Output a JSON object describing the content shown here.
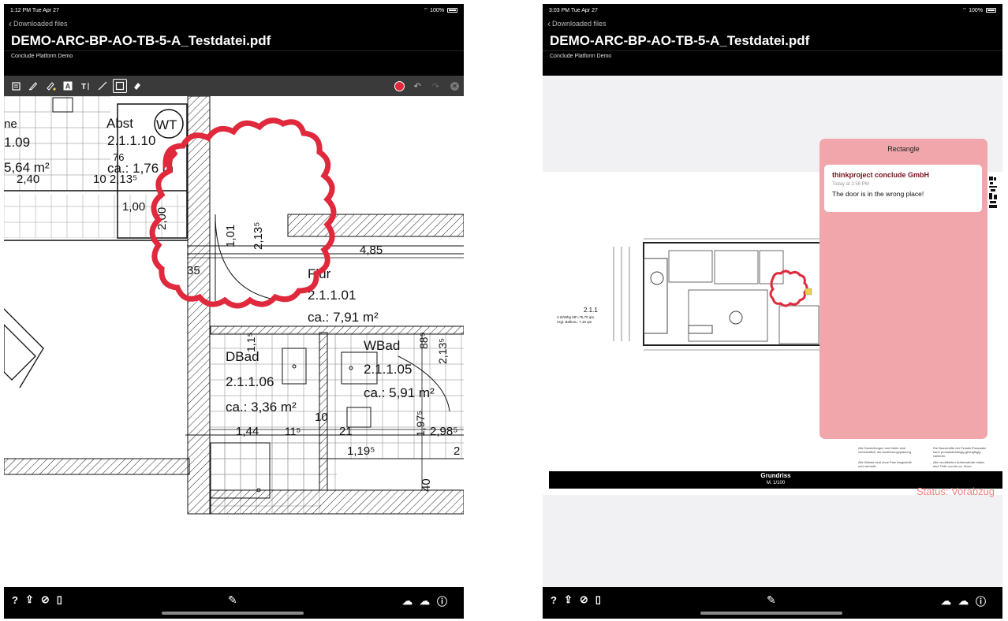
{
  "left": {
    "status": {
      "time": "1:12 PM  Tue Apr 27",
      "battery": "100%"
    },
    "back_label": "Downloaded files",
    "doc_title": "DEMO-ARC-BP-AO-TB-5-A_Testdatei.pdf",
    "project": "Conclude Platform Demo",
    "toolbar": {
      "tools": [
        "note-tool",
        "pen-tool",
        "highlighter-tool",
        "text-box-tool",
        "text-tool",
        "line-tool",
        "rectangle-tool",
        "eraser-tool"
      ],
      "selected_tool": "rectangle-tool",
      "active_color": "#e0293c"
    },
    "plan": {
      "rooms": [
        "Abst",
        "WT",
        "2.1.1.10",
        "ca.: 1,76 m",
        "Flur",
        "2.1.1.01",
        "ca.: 7,91 m²",
        "DBad",
        "2.1.1.06",
        "ca.: 3,36 m²",
        "WBad",
        "2.1.1.05",
        "ca.: 5,91 m²"
      ],
      "dims": [
        "1.09",
        "5,64 m²",
        "2,40",
        "10 2,13⁵",
        "1,00",
        "2,00",
        "1,01",
        "2,13⁵",
        "4,85",
        "35",
        "88⁵",
        "2,13⁵",
        "1,44",
        "11⁵",
        "10",
        "21",
        "1,97⁵",
        "2,98⁵",
        "1,19⁵",
        "2",
        "40",
        "ne",
        "76",
        "1,1⁵"
      ]
    }
  },
  "right": {
    "status": {
      "time": "3:03 PM  Tue Apr 27",
      "battery": "100%"
    },
    "back_label": "Downloaded files",
    "doc_title": "DEMO-ARC-BP-AO-TB-5-A_Testdatei.pdf",
    "project": "Conclude Platform Demo",
    "plan": {
      "unit": "2.1.1",
      "unit_info_1": "3 Zi/Whg  MF=75,70 qm",
      "unit_info_2": "zzgl.  Balkon= 7,18 qm",
      "title_block": "Grundriss",
      "scale": "M. 1/100",
      "status_stamp": "Status: Vorabzug"
    },
    "comment": {
      "title": "Rectangle",
      "author": "thinkproject conclude GmbH",
      "time": "Today at 2:56 PM",
      "text": "The door is in the wrong place!"
    }
  },
  "bottom_bar": {
    "left_icons": [
      "help-icon",
      "share-icon",
      "hide-icon",
      "pdf-icon"
    ],
    "center_icon": "pencil-icon",
    "right_icons": [
      "cloud-sync-icon",
      "cloud-upload-icon",
      "info-icon"
    ]
  }
}
